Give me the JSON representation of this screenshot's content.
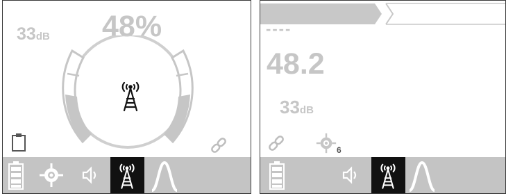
{
  "left_screen": {
    "noise_value": "33",
    "noise_unit": "dB",
    "signal_percent": "48%",
    "signal_level_fraction": 0.48,
    "center_icon": "radio-tower-icon",
    "clipboard_icon": "clipboard-icon",
    "link_icon": "link-icon",
    "bottom_bar": [
      {
        "icon": "battery-icon",
        "active": false
      },
      {
        "icon": "gps-target-icon",
        "active": false
      },
      {
        "icon": "speaker-icon",
        "active": false
      },
      {
        "icon": "radio-tower-icon",
        "active": true
      },
      {
        "icon": "peak-curve-icon",
        "active": false
      }
    ]
  },
  "right_screen": {
    "depth_placeholder": "----",
    "value": "48.2",
    "noise_value": "33",
    "noise_unit": "dB",
    "link_icon": "link-icon",
    "gps_icon": "gps-target-icon",
    "gps_count": "6",
    "bottom_bar": [
      {
        "icon": "battery-icon",
        "active": false
      },
      {
        "icon": "speaker-icon",
        "active": false
      },
      {
        "icon": "radio-tower-icon",
        "active": true
      },
      {
        "icon": "peak-curve-icon",
        "active": false
      }
    ]
  },
  "colors": {
    "frame": "#3a3a3a",
    "muted_text": "#c6c6c6",
    "bar_background": "#c4c4c4",
    "active_tile": "#111111"
  }
}
